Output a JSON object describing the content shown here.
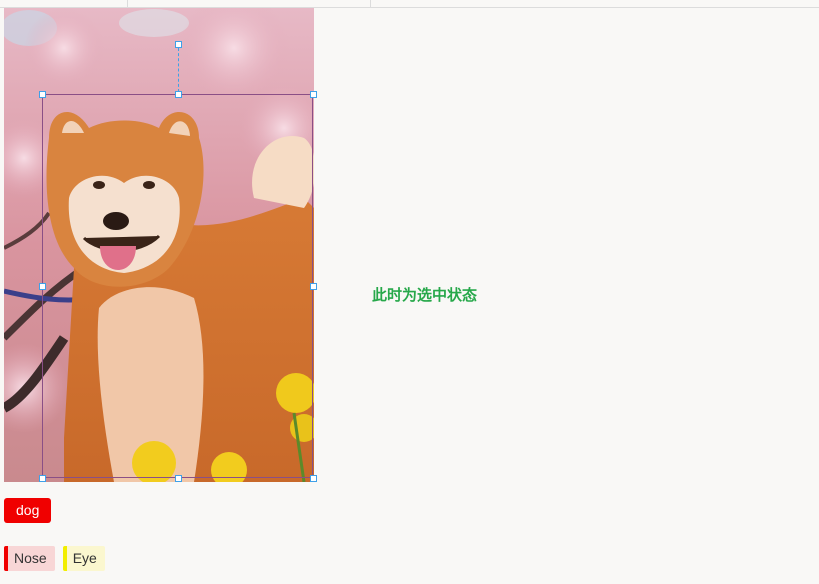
{
  "status_text": "此时为选中状态",
  "selected_label": "dog",
  "tags": [
    {
      "label": "Nose",
      "color": "#f00000",
      "bg": "#f8d6d6"
    },
    {
      "label": "Eye",
      "color": "#f2ee00",
      "bg": "#fbf7cf"
    }
  ],
  "colors": {
    "bbox_border": "#8a4f86",
    "handle_border": "#3fa0e8",
    "status_green": "#27a84a",
    "label_red": "#f00000"
  }
}
